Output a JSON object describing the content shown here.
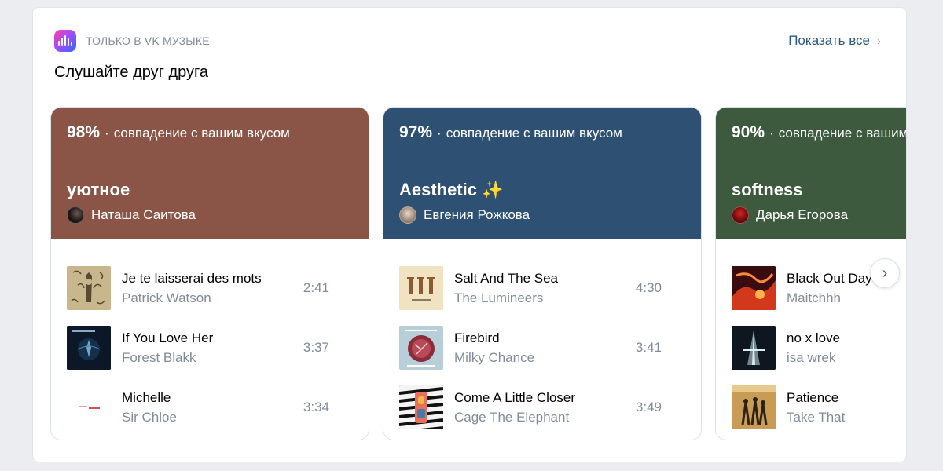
{
  "header": {
    "eyebrow": "ТОЛЬКО В VK МУЗЫКЕ",
    "title": "Слушайте друг друга",
    "show_all": "Показать все",
    "brand_gradient": [
      "#ff3fa0",
      "#9a4dff",
      "#2f6bff"
    ]
  },
  "playlists": [
    {
      "match_pct": "98%",
      "match_text": "совпадение с вашим вкусом",
      "title": "уютное",
      "owner": "Наташа Саитова",
      "color": "#8a5546",
      "tracks": [
        {
          "title": "Je te laisserai des mots",
          "artist": "Patrick Watson",
          "duration": "2:41"
        },
        {
          "title": "If You Love Her",
          "artist": "Forest Blakk",
          "duration": "3:37"
        },
        {
          "title": "Michelle",
          "artist": "Sir Chloe",
          "duration": "3:34"
        }
      ]
    },
    {
      "match_pct": "97%",
      "match_text": "совпадение с вашим вкусом",
      "title": "Aesthetic ✨",
      "owner": "Евгения Рожкова",
      "color": "#2e5072",
      "tracks": [
        {
          "title": "Salt And The Sea",
          "artist": "The Lumineers",
          "duration": "4:30"
        },
        {
          "title": "Firebird",
          "artist": "Milky Chance",
          "duration": "3:41"
        },
        {
          "title": "Come A Little Closer",
          "artist": "Cage The Elephant",
          "duration": "3:49"
        }
      ]
    },
    {
      "match_pct": "90%",
      "match_text": "совпадение с вашим вкусом",
      "title": "softness",
      "owner": "Дарья Егорова",
      "color": "#3d5a3f",
      "tracks": [
        {
          "title": "Black Out Days",
          "artist": "Maitchhh",
          "duration": ""
        },
        {
          "title": "no x love",
          "artist": "isa wrek",
          "duration": ""
        },
        {
          "title": "Patience",
          "artist": "Take That",
          "duration": ""
        }
      ]
    }
  ],
  "icons": {
    "show_all_chevron": "chevron-right-icon",
    "next_button": "chevron-right-icon"
  }
}
